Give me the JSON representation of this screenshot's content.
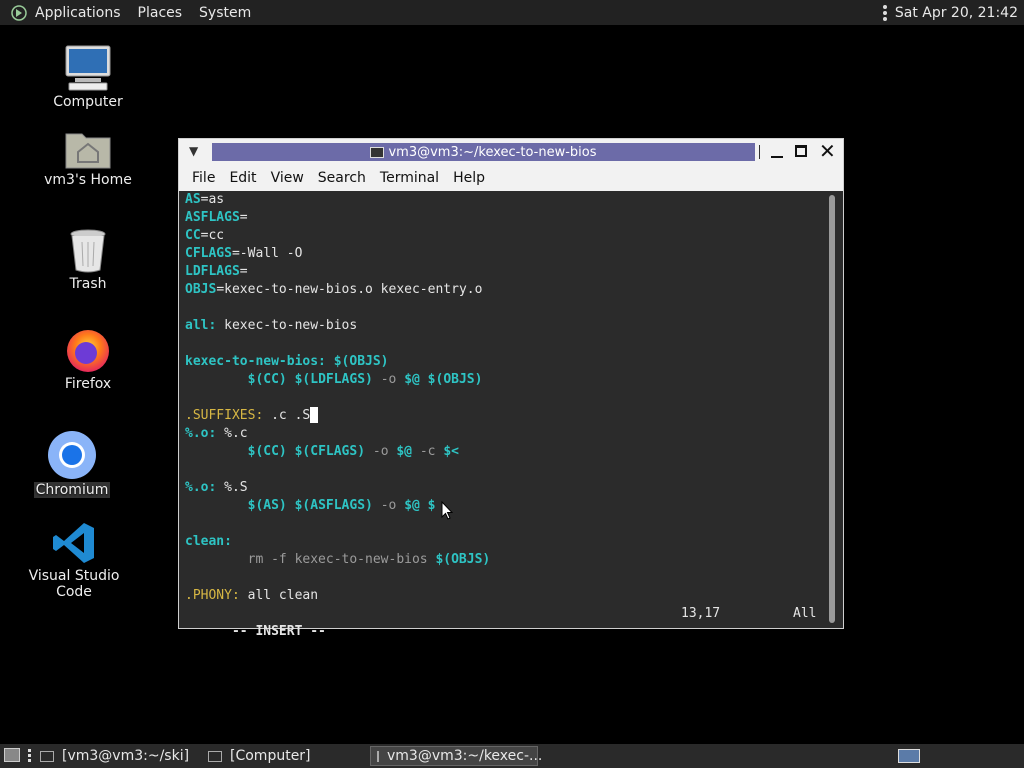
{
  "top_panel": {
    "menus": [
      "Applications",
      "Places",
      "System"
    ],
    "clock": "Sat Apr 20, 21:42"
  },
  "desktop_icons": [
    "Computer",
    "vm3's Home",
    "Trash",
    "Firefox",
    "Chromium",
    "Visual Studio Code"
  ],
  "terminal": {
    "title": "vm3@vm3:~/kexec-to-new-bios",
    "menu": [
      "File",
      "Edit",
      "View",
      "Search",
      "Terminal",
      "Help"
    ],
    "lines": [
      [
        {
          "t": "AS",
          "c": "cy"
        },
        {
          "t": "=as",
          "c": "w"
        }
      ],
      [
        {
          "t": "ASFLAGS",
          "c": "cy"
        },
        {
          "t": "=",
          "c": "w"
        }
      ],
      [
        {
          "t": "CC",
          "c": "cy"
        },
        {
          "t": "=cc",
          "c": "w"
        }
      ],
      [
        {
          "t": "CFLAGS",
          "c": "cy"
        },
        {
          "t": "=-Wall -O",
          "c": "w"
        }
      ],
      [
        {
          "t": "LDFLAGS",
          "c": "cy"
        },
        {
          "t": "=",
          "c": "w"
        }
      ],
      [
        {
          "t": "OBJS",
          "c": "cy"
        },
        {
          "t": "=kexec-to-new-bios.o kexec-entry.o",
          "c": "w"
        }
      ],
      [],
      [
        {
          "t": "all:",
          "c": "cy"
        },
        {
          "t": " kexec-to-new-bios",
          "c": "w"
        }
      ],
      [],
      [
        {
          "t": "kexec-to-new-bios:",
          "c": "cy"
        },
        {
          "t": " ",
          "c": "w"
        },
        {
          "t": "$(OBJS)",
          "c": "cy"
        }
      ],
      [
        {
          "t": "        ",
          "c": "w"
        },
        {
          "t": "$(CC)",
          "c": "cy"
        },
        {
          "t": " ",
          "c": "w"
        },
        {
          "t": "$(LDFLAGS)",
          "c": "cy"
        },
        {
          "t": " -o ",
          "c": "gr"
        },
        {
          "t": "$@",
          "c": "cy"
        },
        {
          "t": " ",
          "c": "w"
        },
        {
          "t": "$(OBJS)",
          "c": "cy"
        }
      ],
      [],
      [
        {
          "t": ".SUFFIXES:",
          "c": "yl"
        },
        {
          "t": " .c .S",
          "c": "w"
        },
        {
          "t": "",
          "c": "cursor"
        }
      ],
      [
        {
          "t": "%.o:",
          "c": "cy"
        },
        {
          "t": " %.c",
          "c": "w"
        }
      ],
      [
        {
          "t": "        ",
          "c": "w"
        },
        {
          "t": "$(CC)",
          "c": "cy"
        },
        {
          "t": " ",
          "c": "w"
        },
        {
          "t": "$(CFLAGS)",
          "c": "cy"
        },
        {
          "t": " -o ",
          "c": "gr"
        },
        {
          "t": "$@",
          "c": "cy"
        },
        {
          "t": " -c ",
          "c": "gr"
        },
        {
          "t": "$<",
          "c": "cy"
        }
      ],
      [],
      [
        {
          "t": "%.o:",
          "c": "cy"
        },
        {
          "t": " %.S",
          "c": "w"
        }
      ],
      [
        {
          "t": "        ",
          "c": "w"
        },
        {
          "t": "$(AS)",
          "c": "cy"
        },
        {
          "t": " ",
          "c": "w"
        },
        {
          "t": "$(ASFLAGS)",
          "c": "cy"
        },
        {
          "t": " -o ",
          "c": "gr"
        },
        {
          "t": "$@",
          "c": "cy"
        },
        {
          "t": " $",
          "c": "cy"
        }
      ],
      [],
      [
        {
          "t": "clean:",
          "c": "cy"
        }
      ],
      [
        {
          "t": "        rm -f kexec-to-new-bios ",
          "c": "gr"
        },
        {
          "t": "$(OBJS)",
          "c": "cy"
        }
      ],
      [],
      [
        {
          "t": ".PHONY:",
          "c": "yl"
        },
        {
          "t": " all clean",
          "c": "w"
        }
      ]
    ],
    "status": {
      "mode": "-- INSERT --",
      "position": "13,17",
      "scroll": "All"
    }
  },
  "taskbar": {
    "tasks": [
      "[vm3@vm3:~/ski]",
      "[Computer]",
      "vm3@vm3:~/kexec-..."
    ]
  },
  "colors": {
    "keyword": "#2ec4c4",
    "directive": "#d7b744",
    "flag": "#9b9b9b",
    "titlebar_active": "#6c6ba8"
  }
}
